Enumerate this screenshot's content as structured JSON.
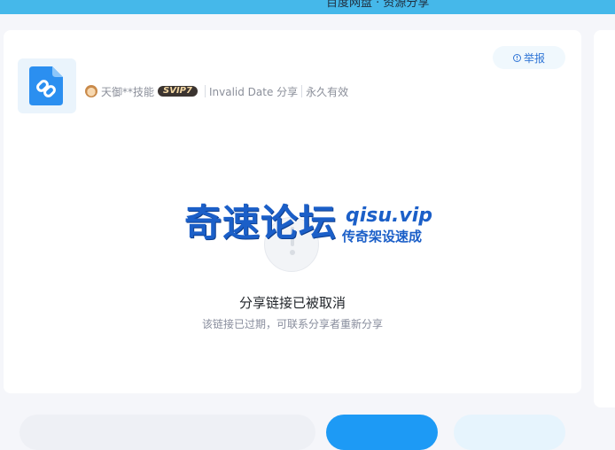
{
  "window": {
    "title": "百度网盘 · 资源分享"
  },
  "header": {
    "report_label": "举报"
  },
  "share": {
    "username": "天御**技能",
    "vip_badge": "SVIP7",
    "date_text": "Invalid Date 分享",
    "validity": "永久有效"
  },
  "watermark": {
    "main": "奇速论坛",
    "site": "qisu.vip",
    "sub": "传奇架设速成"
  },
  "status": {
    "title": "分享链接已被取消",
    "description": "该链接已过期，可联系分享者重新分享"
  },
  "icons": {
    "file": "link-file-icon",
    "report": "alert-circle-icon",
    "empty": "exclamation-icon",
    "avatar": "user-avatar"
  },
  "colors": {
    "topbar": "#45b8ea",
    "accent": "#1d9af5",
    "watermark": "#1b5fc8",
    "vip_badge": "#3b3430"
  }
}
